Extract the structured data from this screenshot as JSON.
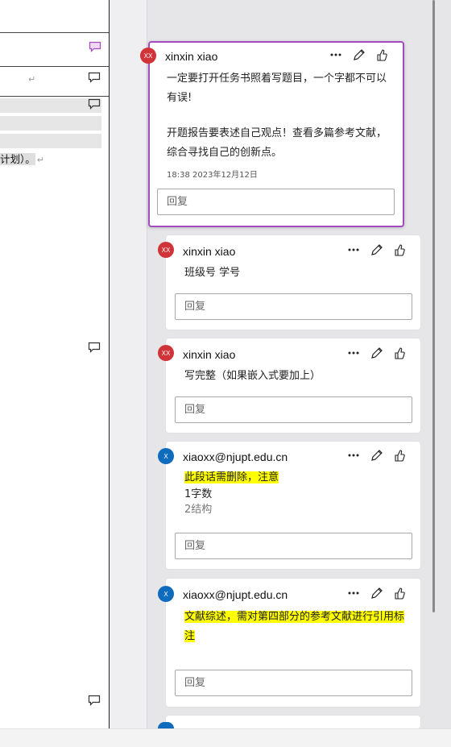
{
  "document": {
    "paragraph_text": "计划）。",
    "return_mark": "↵"
  },
  "comments": [
    {
      "avatar": "XX",
      "author": "xinxin xiao",
      "lines": [
        "一定要打开任务书照着写题目，一个字都不可以",
        "有误!",
        "",
        "开题报告要表述自己观点！查看多篇参考文献，",
        "综合寻找自己的创新点。"
      ],
      "timestamp": "18:38 2023年12月12日",
      "reply_placeholder": "回复"
    },
    {
      "avatar": "XX",
      "author": "xinxin xiao",
      "lines": [
        "班级号 学号"
      ],
      "reply_placeholder": "回复"
    },
    {
      "avatar": "XX",
      "author": "xinxin xiao",
      "lines": [
        "写完整（如果嵌入式要加上）"
      ],
      "reply_placeholder": "回复"
    },
    {
      "avatar": "X",
      "author": "xiaoxx@njupt.edu.cn",
      "highlight": "此段话需删除，注意",
      "lines": [
        "1字数",
        "2结构"
      ],
      "reply_placeholder": "回复"
    },
    {
      "avatar": "X",
      "author": "xiaoxx@njupt.edu.cn",
      "highlight_lines": [
        "文献综述，需对第四部分的参考文献进行引用标",
        "注"
      ],
      "reply_placeholder": "回复"
    },
    {
      "avatar": "X"
    }
  ],
  "colors": {
    "active_border": "#a54bc0",
    "avatar_red": "#d13438",
    "avatar_blue": "#0f6cbd",
    "highlight": "#ffff00"
  },
  "icons": {
    "more": "more-options-icon",
    "edit": "pencil-icon",
    "like": "thumbs-up-icon",
    "comment": "comment-bubble-icon"
  }
}
